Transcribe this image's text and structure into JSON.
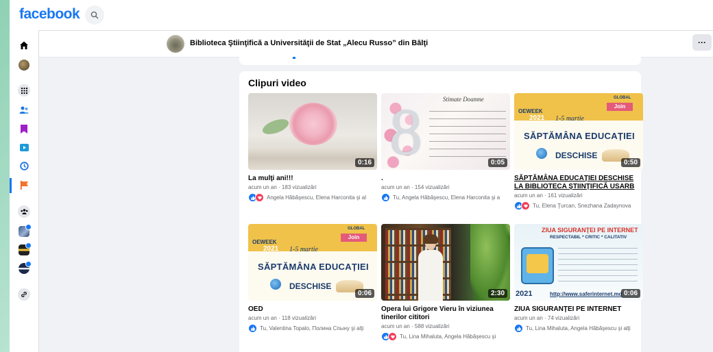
{
  "topbar": {
    "logo": "facebook",
    "search_icon": "search-icon"
  },
  "sidebar": {
    "items": [
      {
        "icon": "home-icon"
      },
      {
        "icon": "profile-avatar-icon"
      },
      {
        "icon": "menu-grid-icon"
      },
      {
        "icon": "friends-icon"
      },
      {
        "icon": "saved-icon"
      },
      {
        "icon": "watch-icon"
      },
      {
        "icon": "memories-icon"
      },
      {
        "icon": "pages-flag-icon"
      },
      {
        "icon": "groups-icon"
      },
      {
        "icon": "group-shortcut-icon"
      },
      {
        "icon": "group-shortcut-icon"
      },
      {
        "icon": "group-shortcut-icon"
      },
      {
        "icon": "link-icon"
      }
    ]
  },
  "page_header": {
    "name": "Biblioteca Ştiinţifică a Universităţii de Stat „Alecu Russo” din Bălţi",
    "more_label": "···"
  },
  "videos_section": {
    "title": "Clipuri video",
    "videos": [
      {
        "duration": "0:16",
        "title": "La mulţi ani!!!",
        "meta": "acum un an · 183 vizualizări",
        "reactions": "Angela Hăbăşescu, Elena Harconita şi al",
        "has_love": true
      },
      {
        "duration": "0:05",
        "title": ".",
        "meta": "acum un an · 154 vizualizări",
        "reactions": "Tu, Angela Hăbăşescu, Elena Harconita şi a",
        "has_love": false
      },
      {
        "duration": "0:50",
        "title": "SĂPTĂMÂNA EDUCAȚIEI DESCHISE LA BIBLIOTECA ŞTIINŢIFICĂ USARB",
        "meta": "acum un an · 161 vizualizări",
        "reactions": "Tu, Elena Ţurcan, Snezhana Zadaynova",
        "has_love": true
      },
      {
        "duration": "0:06",
        "title": "OED",
        "meta": "acum un an · 118 vizualizări",
        "reactions": "Tu, Valentina Topalo, Полина Спыну şi alţi",
        "has_love": false
      },
      {
        "duration": "2:30",
        "title": "Opera lui Grigore Vieru în viziunea tinerilor cititori",
        "meta": "acum un an · 588 vizualizări",
        "reactions": "Tu, Lina Mihaluta, Angela Hăbăşescu şi",
        "has_love": true
      },
      {
        "duration": "0:06",
        "title": "ZIUA SIGURANŢEI PE INTERNET",
        "meta": "acum un an · 74 vizualizări",
        "reactions": "Tu, Lina Mihaluta, Angela Hăbăşescu şi alţi",
        "has_love": false
      }
    ]
  },
  "thumb_text": {
    "oeweek_label": "OEWEEK",
    "oeweek_year": "2021",
    "oeweek_dates": "1-5 martie",
    "oeweek_join": "Join",
    "oeweek_global": "GLOBAL",
    "oeweek_main1": "SĂPTĂMÂNA EDUCAȚIEI",
    "oeweek_main2": "DESCHISE",
    "safer_title": "ZIUA SIGURANŢEI PE INTERNET",
    "safer_sub": "RESPECTABIL * CRITIC * CALITATIV",
    "safer_url": "http://www.saferinternet.md",
    "safer_year": "2021",
    "eight_text": "Stimate Doamne"
  },
  "colors": {
    "brand": "#1877f2",
    "like": "#1877f2",
    "love": "#f33e58"
  }
}
